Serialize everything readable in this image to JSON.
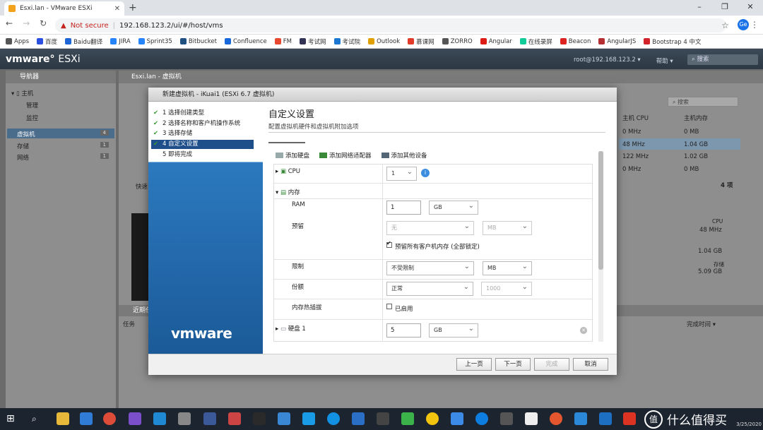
{
  "browser": {
    "tab_title": "Esxi.lan - VMware ESXi",
    "not_secure": "Not secure",
    "url": "192.168.123.2/ui/#/host/vms",
    "profile": "Ge"
  },
  "bookmarks": [
    {
      "label": "Apps",
      "color": "#555"
    },
    {
      "label": "百度",
      "color": "#2b4fe0"
    },
    {
      "label": "Baidu翻译",
      "color": "#1e66d6"
    },
    {
      "label": "JIRA",
      "color": "#2684ff"
    },
    {
      "label": "Sprint35",
      "color": "#2684ff"
    },
    {
      "label": "Bitbucket",
      "color": "#205081"
    },
    {
      "label": "Confluence",
      "color": "#1868db"
    },
    {
      "label": "FM",
      "color": "#e8482f"
    },
    {
      "label": "考试网",
      "color": "#335"
    },
    {
      "label": "考试院",
      "color": "#1b77d2"
    },
    {
      "label": "Outlook",
      "color": "#e0a100"
    },
    {
      "label": "慕课网",
      "color": "#e23b2a"
    },
    {
      "label": "ZORRO",
      "color": "#555"
    },
    {
      "label": "Angular",
      "color": "#dd1b16"
    },
    {
      "label": "在线录屏",
      "color": "#1c9"
    },
    {
      "label": "Beacon",
      "color": "#d22"
    },
    {
      "label": "AngularJS",
      "color": "#b52e31"
    },
    {
      "label": "Bootstrap 4 中文",
      "color": "#d2232a"
    }
  ],
  "esxi": {
    "logo_a": "vmware",
    "logo_b": "ESXi",
    "user": "root@192.168.123.2 ▾",
    "help": "帮助 ▾",
    "search": "搜索"
  },
  "navigator": {
    "title": "导航器",
    "host": "主机",
    "manage": "管理",
    "monitor": "监控",
    "vms": "虚拟机",
    "vms_count": "4",
    "storage": "存储",
    "storage_count": "1",
    "network": "网络",
    "network_count": "1"
  },
  "content": {
    "title": "Esxi.lan - 虚拟机",
    "search": "搜索",
    "col_cpu": "主机 CPU",
    "col_mem": "主机内存",
    "rows": [
      {
        "cpu": "0 MHz",
        "mem": "0 MB"
      },
      {
        "cpu": "48 MHz",
        "mem": "1.04 GB"
      },
      {
        "cpu": "122 MHz",
        "mem": "1.02 GB"
      },
      {
        "cpu": "0 MHz",
        "mem": "0 MB"
      }
    ],
    "quick": "快速",
    "items": "4 项",
    "cpu_label": "CPU",
    "cpu_val": "48 MHz",
    "mem_val": "1.04 GB",
    "store_label": "存储",
    "store_val": "5.09 GB",
    "recent_tasks": "近期任务",
    "task_col": "任务",
    "done_col": "完成时间 ▾"
  },
  "dialog": {
    "title": "新建虚拟机 - iKuai1 (ESXi 6.7 虚拟机)",
    "steps": [
      "1 选择创建类型",
      "2 选择名称和客户机操作系统",
      "3 选择存储",
      "4 自定义设置",
      "5 即将完成"
    ],
    "heading": "自定义设置",
    "subheading": "配置虚拟机硬件和虚拟机附加选项",
    "add_disk": "添加硬盘",
    "add_nic": "添加网络适配器",
    "add_other": "添加其他设备",
    "cpu_label": "CPU",
    "cpu_value": "1",
    "mem_label": "内存",
    "ram_label": "RAM",
    "ram_value": "1",
    "ram_unit": "GB",
    "reserve_label": "预留",
    "reserve_value": "无",
    "reserve_unit": "MB",
    "reserve_all": "预留所有客户机内存 (全部锁定)",
    "limit_label": "限制",
    "limit_value": "不受限制",
    "limit_unit": "MB",
    "shares_label": "份额",
    "shares_value": "正常",
    "shares_num": "1000",
    "hotplug_label": "内存热插拔",
    "hotplug_value": "已启用",
    "disk_label": "硬盘 1",
    "disk_value": "5",
    "disk_unit": "GB",
    "logo": "vmware",
    "btn_back": "上一页",
    "btn_next": "下一页",
    "btn_finish": "完成",
    "btn_cancel": "取消"
  },
  "taskbar": {
    "brand": "什么值得买",
    "brand_icon": "值",
    "time": "3/25/2020"
  }
}
